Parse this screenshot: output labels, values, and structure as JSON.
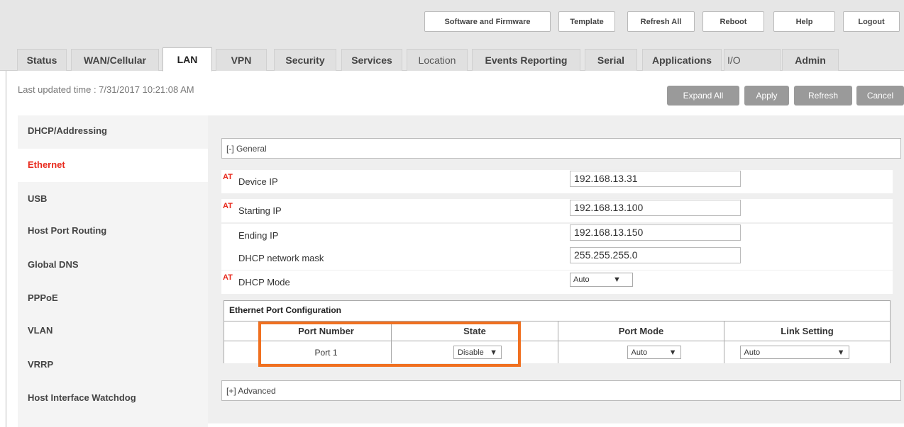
{
  "top_buttons": [
    "Software and Firmware",
    "Template",
    "Refresh All",
    "Reboot",
    "Help",
    "Logout"
  ],
  "tabs": [
    {
      "label": "Status"
    },
    {
      "label": "WAN/Cellular"
    },
    {
      "label": "LAN",
      "active": true
    },
    {
      "label": "VPN"
    },
    {
      "label": "Security"
    },
    {
      "label": "Services"
    },
    {
      "label": "Location"
    },
    {
      "label": "Events Reporting"
    },
    {
      "label": "Serial"
    },
    {
      "label": "Applications"
    },
    {
      "label": "I/O"
    },
    {
      "label": "Admin"
    }
  ],
  "last_updated": "Last updated time : 7/31/2017 10:21:08 AM",
  "action_buttons": [
    "Expand All",
    "Apply",
    "Refresh",
    "Cancel"
  ],
  "sidebar": {
    "items": [
      "DHCP/Addressing",
      "Ethernet",
      "USB",
      "Host Port Routing",
      "Global DNS",
      "PPPoE",
      "VLAN",
      "VRRP",
      "Host Interface Watchdog"
    ],
    "active": "Ethernet"
  },
  "general": {
    "header": "[-] General",
    "at_marker": "AT",
    "fields": [
      {
        "label": "Device IP",
        "value": "192.168.13.31"
      },
      {
        "label": "Starting IP",
        "value": "192.168.13.100"
      },
      {
        "label": "Ending IP",
        "value": "192.168.13.150"
      },
      {
        "label": "DHCP network mask",
        "value": "255.255.255.0"
      },
      {
        "label": "DHCP Mode",
        "value": "Auto"
      }
    ]
  },
  "ethernet_port_config": {
    "title": "Ethernet Port Configuration",
    "headers": [
      "Port Number",
      "State",
      "Port Mode",
      "Link Setting"
    ],
    "rows": [
      {
        "port": "Port 1",
        "state": "Disable",
        "port_mode": "Auto",
        "link_setting": "Auto"
      }
    ]
  },
  "advanced": {
    "header": "[+] Advanced"
  },
  "colors": {
    "accent_red": "#e8291c",
    "highlight_orange": "#f07020",
    "button_gray": "#9a9a9a"
  },
  "icons": {
    "dropdown": "triangle-down-icon"
  }
}
